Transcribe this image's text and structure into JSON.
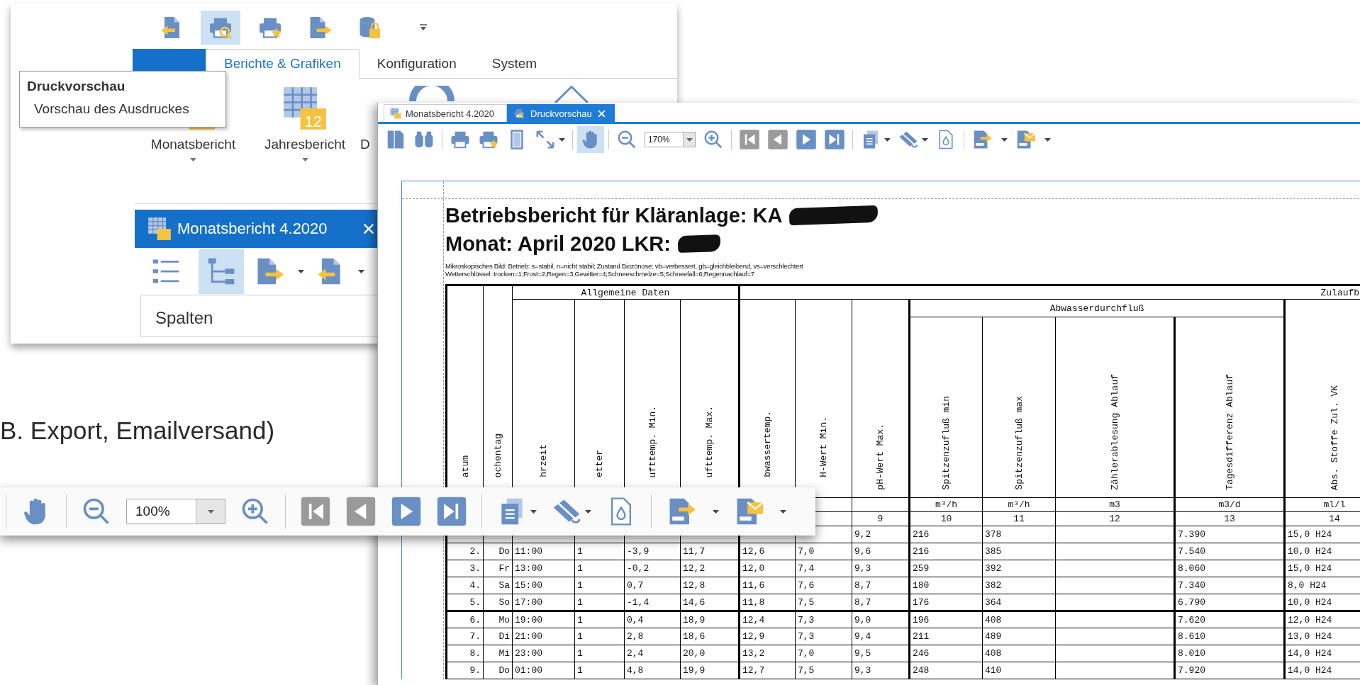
{
  "slide_text": "B. Export, Emailversand)",
  "main_window": {
    "quick_access": [
      {
        "selected": false
      },
      {
        "selected": true
      },
      {
        "selected": false
      },
      {
        "selected": false
      },
      {
        "selected": false
      }
    ],
    "ribbon_tabs": [
      {
        "label": "Berichte & Grafiken",
        "selected": true
      },
      {
        "label": "Konfiguration",
        "selected": false
      },
      {
        "label": "System",
        "selected": false
      }
    ],
    "tooltip": {
      "title": "Druckvorschau",
      "text": "Vorschau des Ausdruckes"
    },
    "ribbon_buttons": [
      {
        "label": "Monatsbericht",
        "dropdown": true
      },
      {
        "label": "Jahresbericht",
        "icon_text": "12",
        "dropdown": true
      },
      {
        "label": "D",
        "dropdown": false
      }
    ],
    "report_panel": {
      "title": "Monatsbericht 4.2020",
      "tools": [
        {
          "selected": false
        },
        {
          "selected": true
        }
      ],
      "section": "Spalten"
    }
  },
  "preview_window": {
    "tabs": [
      {
        "label": "Monatsbericht 4.2020",
        "selected": false
      },
      {
        "label": "Druckvorschau",
        "selected": true
      }
    ],
    "toolbar": {
      "hand_tool": {
        "selected": true
      },
      "zoom": "170%",
      "nav_buttons": [
        {
          "disabled": true
        },
        {
          "disabled": true
        },
        {
          "disabled": false
        },
        {
          "disabled": false
        }
      ]
    },
    "report": {
      "title": "Betriebsbericht für Kläranlage: KA",
      "subtitle": "Monat: April 2020 LKR:",
      "notes": [
        "Mikroskopisches Bild: Betrieb: s=stabil, n=nicht stabil; Zustand Biozönose: vb=verbessert, gb=gleichbleibend, vs=verschlechtert",
        "Wetterschlüssel: trocken=1;Frost=2;Regen=3;Gewitter=4;Schneeschmelze=5;Schneefall=6;Regennachlauf=7"
      ],
      "table": {
        "groups": [
          {
            "label": "Allgemeine Daten"
          },
          {
            "label": "Zulaufb"
          }
        ],
        "subgroup": "Abwasserdurchfluß",
        "columns": [
          {
            "label": "atum"
          },
          {
            "label": "ochentag"
          },
          {
            "label": "hrzeit"
          },
          {
            "label": "etter"
          },
          {
            "label": "ufttemp. Min."
          },
          {
            "label": "ufttemp. Max."
          },
          {
            "label": "bwassertemp."
          },
          {
            "label": "H-Wert Min."
          },
          {
            "label": "pH-Wert Max.",
            "number": "9"
          },
          {
            "label": "Spitzenzufluß min",
            "unit": "m³/h",
            "number": "10"
          },
          {
            "label": "Spitzenzufluß max",
            "unit": "m³/h",
            "number": "11"
          },
          {
            "label": "Zählerablesung Ablauf",
            "unit": "m3",
            "number": "12"
          },
          {
            "label": "Tagesdifferenz Ablauf",
            "unit": "m3/d",
            "number": "13"
          },
          {
            "label": "Abs. Stoffe Zul. VK",
            "unit": "ml/l",
            "number": "14"
          }
        ],
        "rows": [
          {
            "week_start": false,
            "cells": [
              null,
              null,
              null,
              null,
              null,
              null,
              null,
              null,
              "9,2",
              "216",
              "378",
              null,
              "7.390",
              "15,0 H24"
            ]
          },
          {
            "week_start": false,
            "cells": [
              "2.",
              "Do",
              "11:00",
              "1",
              "-3,9",
              "11,7",
              "12,6",
              "7,0",
              "9,6",
              "216",
              "385",
              null,
              "7.540",
              "10,0 H24"
            ]
          },
          {
            "week_start": false,
            "cells": [
              "3.",
              "Fr",
              "13:00",
              "1",
              "-0,2",
              "12,2",
              "12,0",
              "7,4",
              "9,3",
              "259",
              "392",
              null,
              "8.060",
              "15,0 H24"
            ]
          },
          {
            "week_start": false,
            "cells": [
              "4.",
              "Sa",
              "15:00",
              "1",
              "0,7",
              "12,8",
              "11,6",
              "7,6",
              "8,7",
              "180",
              "382",
              null,
              "7.340",
              "8,0 H24"
            ]
          },
          {
            "week_start": false,
            "cells": [
              "5.",
              "So",
              "17:00",
              "1",
              "-1,4",
              "14,6",
              "11,8",
              "7,5",
              "8,7",
              "176",
              "364",
              null,
              "6.790",
              "10,0 H24"
            ]
          },
          {
            "week_start": true,
            "cells": [
              "6.",
              "Mo",
              "19:00",
              "1",
              "0,4",
              "18,9",
              "12,4",
              "7,3",
              "9,0",
              "196",
              "408",
              null,
              "7.620",
              "12,0 H24"
            ]
          },
          {
            "week_start": false,
            "cells": [
              "7.",
              "Di",
              "21:00",
              "1",
              "2,8",
              "18,6",
              "12,9",
              "7,3",
              "9,4",
              "211",
              "489",
              null,
              "8.610",
              "13,0 H24"
            ]
          },
          {
            "week_start": false,
            "cells": [
              "8.",
              "Mi",
              "23:00",
              "1",
              "2,4",
              "20,0",
              "13,2",
              "7,0",
              "9,5",
              "246",
              "408",
              null,
              "8.010",
              "14,0 H24"
            ]
          },
          {
            "week_start": false,
            "cells": [
              "9.",
              "Do",
              "01:00",
              "1",
              "4,8",
              "19,9",
              "12,7",
              "7,5",
              "9,3",
              "248",
              "410",
              null,
              "7.920",
              "14,0 H24"
            ]
          }
        ]
      }
    }
  },
  "floating_toolbar": {
    "hand_tool": {
      "selected": false
    },
    "zoom": "100%",
    "nav_buttons": [
      {
        "disabled": true
      },
      {
        "disabled": true
      },
      {
        "disabled": false
      },
      {
        "disabled": false
      }
    ]
  }
}
